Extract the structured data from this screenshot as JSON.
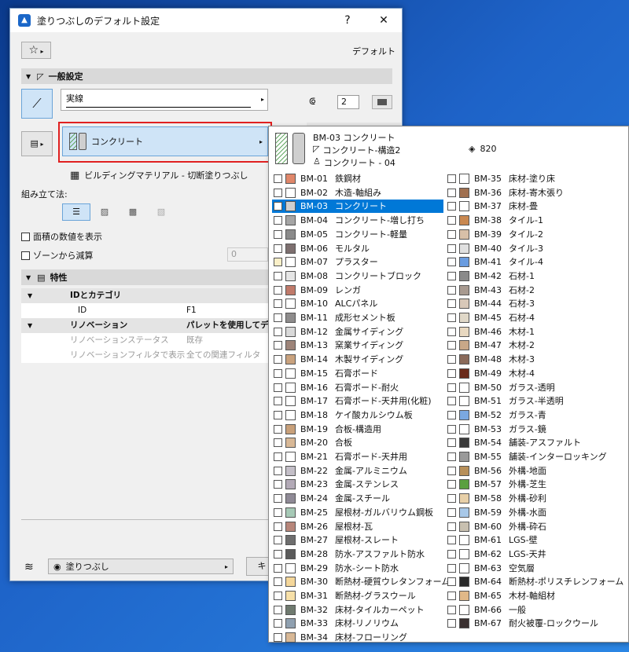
{
  "dialog": {
    "title": "塗りつぶしのデフォルト設定",
    "help": "?",
    "close": "✕",
    "favorite_label": "デフォルト",
    "general_section": "一般設定",
    "line_type": "実線",
    "pen_number": "2",
    "fill_selector": "コンクリート",
    "material_caption": "ビルディングマテリアル - 切断塗りつぶし",
    "composition_label": "組み立て法:",
    "show_area": "面積の数値を表示",
    "subtract_zone": "ゾーンから減算",
    "subtract_value": "0",
    "properties_section": "特性",
    "properties": [
      {
        "kind": "group",
        "key": "IDとカテゴリ",
        "value": ""
      },
      {
        "kind": "item",
        "key": "ID",
        "value": "F1"
      },
      {
        "kind": "group",
        "key": "リノベーション",
        "value": "パレットを使用してデフ"
      },
      {
        "kind": "sub",
        "key": "リノベーションステータス",
        "value": "既存"
      },
      {
        "kind": "sub",
        "key": "リノベーションフィルタで表示",
        "value": "全ての関連フィルタ"
      }
    ],
    "footer_layer": "塗りつぶし",
    "footer_btn": "キ"
  },
  "popup": {
    "header": {
      "name": "BM-03  コンクリート",
      "struct": "コンクリート-構造2",
      "priority": "820",
      "category": "コンクリート - 04"
    },
    "col1": [
      {
        "code": "BM-01",
        "name": "鉄鋼材",
        "color": "#e0876a",
        "pat": ""
      },
      {
        "code": "BM-02",
        "name": "木造-軸組み",
        "color": "#ffffff",
        "pat": ""
      },
      {
        "code": "BM-03",
        "name": "コンクリート",
        "color": "#cfcfcf",
        "pat": "hatch",
        "hl": true
      },
      {
        "code": "BM-04",
        "name": "コンクリート-増し打ち",
        "color": "#a5a5a5",
        "pat": ""
      },
      {
        "code": "BM-05",
        "name": "コンクリート-軽量",
        "color": "#8a8a8a",
        "pat": "hatch"
      },
      {
        "code": "BM-06",
        "name": "モルタル",
        "color": "#7d6f6f",
        "pat": ""
      },
      {
        "code": "BM-07",
        "name": "プラスター",
        "color": "#ffffff",
        "pat": "yl"
      },
      {
        "code": "BM-08",
        "name": "コンクリートブロック",
        "color": "#e6e6e6",
        "pat": "hatch"
      },
      {
        "code": "BM-09",
        "name": "レンガ",
        "color": "#c07a6a",
        "pat": "hatchr"
      },
      {
        "code": "BM-10",
        "name": "ALCパネル",
        "color": "#ffffff",
        "pat": ""
      },
      {
        "code": "BM-11",
        "name": "成形セメント板",
        "color": "#8e8c8c",
        "pat": ""
      },
      {
        "code": "BM-12",
        "name": "金属サイディング",
        "color": "#d9d9d9",
        "pat": ""
      },
      {
        "code": "BM-13",
        "name": "窯業サイディング",
        "color": "#9d8479",
        "pat": ""
      },
      {
        "code": "BM-14",
        "name": "木製サイディング",
        "color": "#c9a27e",
        "pat": ""
      },
      {
        "code": "BM-15",
        "name": "石膏ボード",
        "color": "#ffffff",
        "pat": ""
      },
      {
        "code": "BM-16",
        "name": "石膏ボード-耐火",
        "color": "#ffffff",
        "pat": ""
      },
      {
        "code": "BM-17",
        "name": "石膏ボード-天井用(化粧)",
        "color": "#ffffff",
        "pat": ""
      },
      {
        "code": "BM-18",
        "name": "ケイ酸カルシウム板",
        "color": "#ffffff",
        "pat": ""
      },
      {
        "code": "BM-19",
        "name": "合板-構造用",
        "color": "#c8a07a",
        "pat": ""
      },
      {
        "code": "BM-20",
        "name": "合板",
        "color": "#d8b896",
        "pat": ""
      },
      {
        "code": "BM-21",
        "name": "石膏ボード-天井用",
        "color": "#ffffff",
        "pat": ""
      },
      {
        "code": "BM-22",
        "name": "金属-アルミニウム",
        "color": "#c4bfc8",
        "pat": ""
      },
      {
        "code": "BM-23",
        "name": "金属-ステンレス",
        "color": "#b3aab7",
        "pat": ""
      },
      {
        "code": "BM-24",
        "name": "金属-スチール",
        "color": "#8f8a96",
        "pat": ""
      },
      {
        "code": "BM-25",
        "name": "屋根材-ガルバリウム鋼板",
        "color": "#a6c9b6",
        "pat": ""
      },
      {
        "code": "BM-26",
        "name": "屋根材-瓦",
        "color": "#b7867a",
        "pat": ""
      },
      {
        "code": "BM-27",
        "name": "屋根材-スレート",
        "color": "#6e6e6e",
        "pat": ""
      },
      {
        "code": "BM-28",
        "name": "防水-アスファルト防水",
        "color": "#5a5a5a",
        "pat": ""
      },
      {
        "code": "BM-29",
        "name": "防水-シート防水",
        "color": "#ffffff",
        "pat": ""
      },
      {
        "code": "BM-30",
        "name": "断熱材-硬質ウレタンフォーム",
        "color": "#f5d79a",
        "pat": "cross"
      },
      {
        "code": "BM-31",
        "name": "断熱材-グラスウール",
        "color": "#f7e0a8",
        "pat": "cross"
      },
      {
        "code": "BM-32",
        "name": "床材-タイルカーペット",
        "color": "#6f7a6f",
        "pat": ""
      },
      {
        "code": "BM-33",
        "name": "床材-リノリウム",
        "color": "#8fa0b0",
        "pat": ""
      },
      {
        "code": "BM-34",
        "name": "床材-フローリング",
        "color": "#d8b896",
        "pat": ""
      }
    ],
    "col2": [
      {
        "code": "BM-35",
        "name": "床材-塗り床",
        "color": "#ffffff",
        "pat": ""
      },
      {
        "code": "BM-36",
        "name": "床材-寄木張り",
        "color": "#a07050",
        "pat": ""
      },
      {
        "code": "BM-37",
        "name": "床材-畳",
        "color": "#ffffff",
        "pat": "hatch"
      },
      {
        "code": "BM-38",
        "name": "タイル-1",
        "color": "#c98850",
        "pat": ""
      },
      {
        "code": "BM-39",
        "name": "タイル-2",
        "color": "#d8c0a8",
        "pat": ""
      },
      {
        "code": "BM-40",
        "name": "タイル-3",
        "color": "#e0e0e0",
        "pat": ""
      },
      {
        "code": "BM-41",
        "name": "タイル-4",
        "color": "#6a9ce0",
        "pat": ""
      },
      {
        "code": "BM-42",
        "name": "石材-1",
        "color": "#8a8a8a",
        "pat": "hatch"
      },
      {
        "code": "BM-43",
        "name": "石材-2",
        "color": "#a89a90",
        "pat": "hatchr"
      },
      {
        "code": "BM-44",
        "name": "石材-3",
        "color": "#d8c8b8",
        "pat": "hatchr"
      },
      {
        "code": "BM-45",
        "name": "石材-4",
        "color": "#e0d8c8",
        "pat": "hatchr"
      },
      {
        "code": "BM-46",
        "name": "木材-1",
        "color": "#e8d8c0",
        "pat": "hatchr"
      },
      {
        "code": "BM-47",
        "name": "木材-2",
        "color": "#c8a888",
        "pat": "hatchr"
      },
      {
        "code": "BM-48",
        "name": "木材-3",
        "color": "#8a6a5a",
        "pat": "hatchr"
      },
      {
        "code": "BM-49",
        "name": "木材-4",
        "color": "#6a2a1a",
        "pat": "hatchr"
      },
      {
        "code": "BM-50",
        "name": "ガラス-透明",
        "color": "#ffffff",
        "pat": ""
      },
      {
        "code": "BM-51",
        "name": "ガラス-半透明",
        "color": "#ffffff",
        "pat": ""
      },
      {
        "code": "BM-52",
        "name": "ガラス-青",
        "color": "#7aa8e0",
        "pat": ""
      },
      {
        "code": "BM-53",
        "name": "ガラス-鏡",
        "color": "#ffffff",
        "pat": ""
      },
      {
        "code": "BM-54",
        "name": "舗装-アスファルト",
        "color": "#3a3a3a",
        "pat": ""
      },
      {
        "code": "BM-55",
        "name": "舗装-インターロッキング",
        "color": "#9a9a9a",
        "pat": ""
      },
      {
        "code": "BM-56",
        "name": "外構-地面",
        "color": "#b8905a",
        "pat": "cross"
      },
      {
        "code": "BM-57",
        "name": "外構-芝生",
        "color": "#5aa040",
        "pat": ""
      },
      {
        "code": "BM-58",
        "name": "外構-砂利",
        "color": "#e8d0a8",
        "pat": "cross"
      },
      {
        "code": "BM-59",
        "name": "外構-水面",
        "color": "#a8c8e8",
        "pat": ""
      },
      {
        "code": "BM-60",
        "name": "外構-砕石",
        "color": "#c8c0b0",
        "pat": "cross"
      },
      {
        "code": "BM-61",
        "name": "LGS-壁",
        "color": "#ffffff",
        "pat": ""
      },
      {
        "code": "BM-62",
        "name": "LGS-天井",
        "color": "#ffffff",
        "pat": ""
      },
      {
        "code": "BM-63",
        "name": "空気層",
        "color": "#ffffff",
        "pat": ""
      },
      {
        "code": "BM-64",
        "name": "断熱材-ポリスチレンフォーム",
        "color": "#2a2a2a",
        "pat": "cross"
      },
      {
        "code": "BM-65",
        "name": "木材-軸組材",
        "color": "#e0b888",
        "pat": ""
      },
      {
        "code": "BM-66",
        "name": "一般",
        "color": "#ffffff",
        "pat": ""
      },
      {
        "code": "BM-67",
        "name": "耐火被覆-ロックウール",
        "color": "#3a3030",
        "pat": "cross"
      }
    ]
  }
}
